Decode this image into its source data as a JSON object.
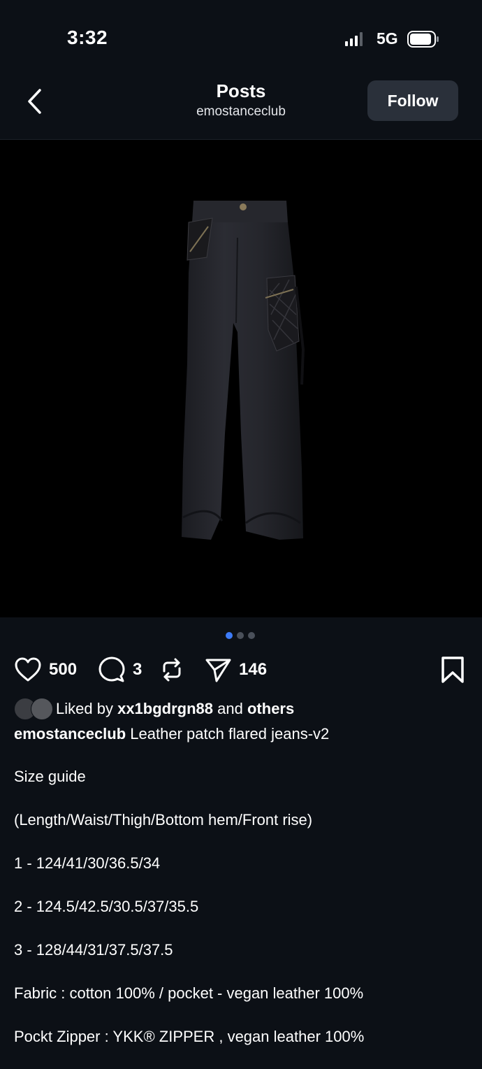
{
  "status_bar": {
    "time": "3:32",
    "network": "5G"
  },
  "header": {
    "title": "Posts",
    "username": "emostanceclub",
    "follow_label": "Follow"
  },
  "media": {
    "pagination": {
      "total": 3,
      "active": 1
    }
  },
  "actions": {
    "likes": "500",
    "comments": "3",
    "shares": "146"
  },
  "liked_by": {
    "prefix": "Liked by",
    "user": "xx1bgdrgn88",
    "joiner": "and",
    "others": "others"
  },
  "caption": {
    "username": "emostanceclub",
    "text": "Leather patch flared jeans-v2",
    "lines": [
      "Size guide",
      "(Length/Waist/Thigh/Bottom hem/Front rise)",
      "1 - 124/41/30/36.5/34",
      "2 - 124.5/42.5/30.5/37/35.5",
      "3 - 128/44/31/37.5/37.5",
      "Fabric : cotton 100% / pocket - vegan leather 100%",
      "Pockt Zipper : YKK®  ZIPPER ,  vegan leather 100%"
    ]
  },
  "icons": {
    "back": "chevron-left-icon",
    "like": "heart-icon",
    "comment": "comment-bubble-icon",
    "repost": "repost-icon",
    "share": "send-icon",
    "bookmark": "bookmark-icon"
  },
  "colors": {
    "background": "#0c1016",
    "follow_button": "#2a303a",
    "active_dot": "#3d7bf7"
  }
}
